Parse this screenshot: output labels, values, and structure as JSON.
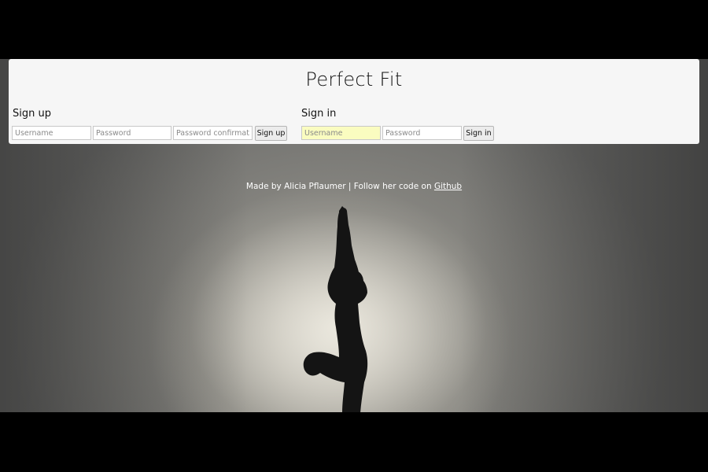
{
  "app": {
    "title": "Perfect Fit"
  },
  "signup": {
    "heading": "Sign up",
    "username_placeholder": "Username",
    "password_placeholder": "Password",
    "password_confirmation_placeholder": "Password confirmation",
    "button_label": "Sign up"
  },
  "signin": {
    "heading": "Sign in",
    "username_placeholder": "Username",
    "password_placeholder": "Password",
    "button_label": "Sign in",
    "username_autofill_color": "#fafcc0"
  },
  "footer": {
    "text": "Made by Alicia Pflaumer | Follow her code on ",
    "link_label": "Github"
  },
  "background": {
    "image": "yoga-silhouette-image"
  }
}
